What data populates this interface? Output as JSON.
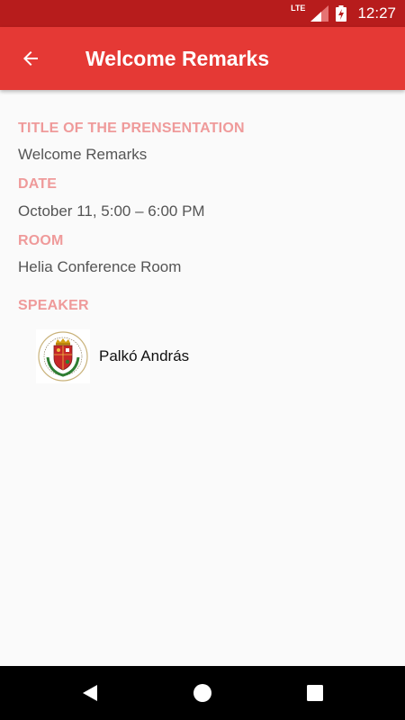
{
  "status_bar": {
    "network": "LTE",
    "time": "12:27"
  },
  "app_bar": {
    "title": "Welcome Remarks",
    "back_icon": "arrow-back-icon"
  },
  "details": {
    "title_label": "TITLE OF THE PRENSENTATION",
    "title_value": "Welcome Remarks",
    "date_label": "DATE",
    "date_value": "October 11, 5:00 – 6:00 PM",
    "room_label": "ROOM",
    "room_value": "Helia Conference Room",
    "speaker_label": "SPEAKER"
  },
  "speakers": [
    {
      "name": "Palkó András",
      "avatar": "university-crest-logo"
    }
  ],
  "nav_bar": {
    "back": "nav-back-icon",
    "home": "nav-home-icon",
    "recents": "nav-recents-icon"
  },
  "colors": {
    "status_bar": "#b71c1c",
    "app_bar": "#e53935",
    "label": "#ef9a9a",
    "background": "#fafafa"
  }
}
